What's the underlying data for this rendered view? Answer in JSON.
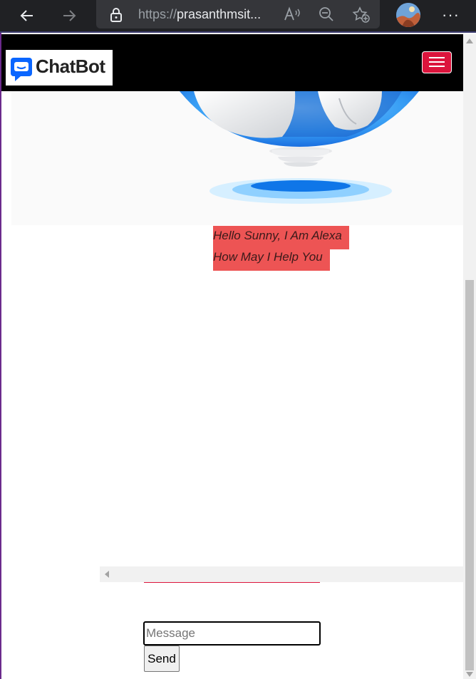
{
  "browser": {
    "url_protocol": "https://",
    "url_host": "prasanthmsit...",
    "icons": [
      "back-arrow-icon",
      "forward-arrow-icon",
      "lock-icon",
      "read-aloud-icon",
      "zoom-out-icon",
      "favorite-add-icon",
      "profile-avatar",
      "more-options-icon"
    ]
  },
  "navbar": {
    "brand": "ChatBot",
    "background": "#000000",
    "toggler_color": "#dc143c"
  },
  "chat": {
    "greeting": " Hello Sunny, I Am Alexa",
    "prompt": "How May I Help You",
    "bubble_color": "#ed5454"
  },
  "composer": {
    "placeholder": "Message",
    "value": "",
    "send_label": "Send"
  }
}
